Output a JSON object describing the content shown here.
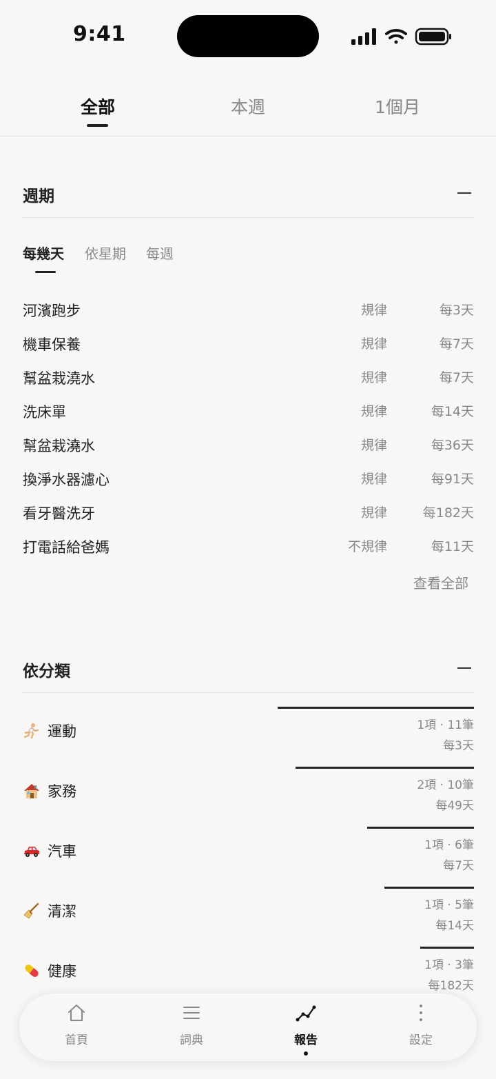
{
  "status_bar": {
    "time": "9:41"
  },
  "tabs": [
    {
      "label": "全部",
      "active": true
    },
    {
      "label": "本週",
      "active": false
    },
    {
      "label": "1個月",
      "active": false
    }
  ],
  "cycle_section": {
    "title": "週期",
    "sub_tabs": [
      {
        "label": "每幾天",
        "active": true
      },
      {
        "label": "依星期",
        "active": false
      },
      {
        "label": "每週",
        "active": false
      }
    ],
    "rows": [
      {
        "name": "河濱跑步",
        "type": "規律",
        "freq": "每3天"
      },
      {
        "name": "機車保養",
        "type": "規律",
        "freq": "每7天"
      },
      {
        "name": "幫盆栽澆水",
        "type": "規律",
        "freq": "每7天"
      },
      {
        "name": "洗床單",
        "type": "規律",
        "freq": "每14天"
      },
      {
        "name": "幫盆栽澆水",
        "type": "規律",
        "freq": "每36天"
      },
      {
        "name": "換淨水器濾心",
        "type": "規律",
        "freq": "每91天"
      },
      {
        "name": "看牙醫洗牙",
        "type": "規律",
        "freq": "每182天"
      },
      {
        "name": "打電話給爸媽",
        "type": "不規律",
        "freq": "每11天"
      }
    ],
    "view_all": "查看全部"
  },
  "category_section": {
    "title": "依分類",
    "rows": [
      {
        "icon": "runner-icon",
        "name": "運動",
        "stats": "1項 · 11筆",
        "freq": "每3天",
        "share": 0.435
      },
      {
        "icon": "house-icon",
        "name": "家務",
        "stats": "2項 · 10筆",
        "freq": "每49天",
        "share": 0.395
      },
      {
        "icon": "car-icon",
        "name": "汽車",
        "stats": "1項 · 6筆",
        "freq": "每7天",
        "share": 0.237
      },
      {
        "icon": "broom-icon",
        "name": "清潔",
        "stats": "1項 · 5筆",
        "freq": "每14天",
        "share": 0.198
      },
      {
        "icon": "pill-icon",
        "name": "健康",
        "stats": "1項 · 3筆",
        "freq": "每182天",
        "share": 0.119
      }
    ]
  },
  "bottom_nav": [
    {
      "icon": "home-icon",
      "label": "首頁",
      "active": false
    },
    {
      "icon": "list-icon",
      "label": "詞典",
      "active": false
    },
    {
      "icon": "chart-line-icon",
      "label": "報告",
      "active": true
    },
    {
      "icon": "more-icon",
      "label": "設定",
      "active": false
    }
  ]
}
